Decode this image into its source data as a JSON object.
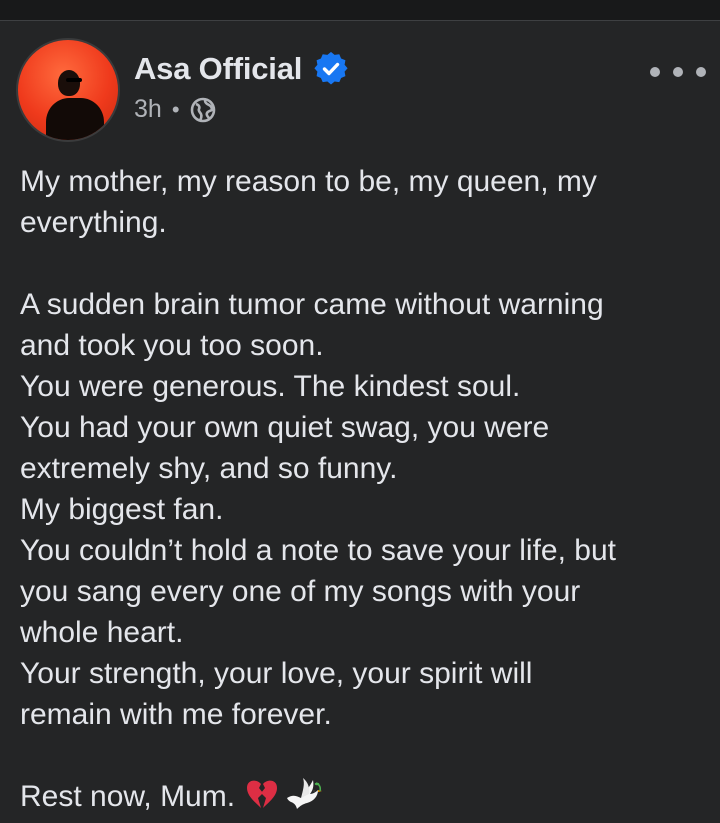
{
  "post": {
    "author": {
      "name": "Asa Official",
      "verified": true,
      "avatar_icon": "profile-photo"
    },
    "meta": {
      "time": "3h",
      "separator": "•",
      "audience_icon": "globe-icon"
    },
    "more_icon": "more-horizontal-icon",
    "text_lines": [
      "My mother, my reason to be, my queen, my",
      "everything.",
      "",
      "A sudden brain tumor came without warning",
      "and took you too soon.",
      "You were generous. The kindest soul.",
      "You had your own quiet swag, you were",
      "extremely shy, and so funny.",
      "My biggest fan.",
      "You couldn’t hold a note to save your life, but",
      "you sang every one of my songs with your",
      "whole heart.",
      "Your strength, your love, your spirit will",
      "remain with me forever.",
      "",
      "Rest now, Mum."
    ],
    "closing_emojis": [
      "broken-heart-icon",
      "dove-icon"
    ]
  },
  "colors": {
    "background": "#242526",
    "text_primary": "#e4e6eb",
    "text_secondary": "#b0b3b8",
    "verified_blue": "#1877f2",
    "heart_red": "#dd2e44"
  }
}
